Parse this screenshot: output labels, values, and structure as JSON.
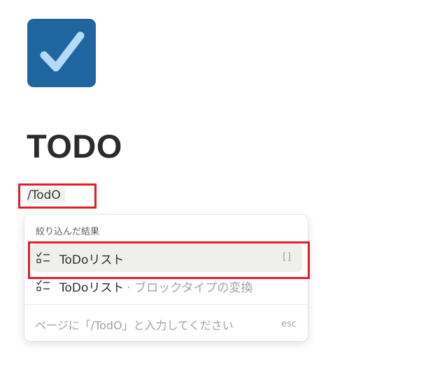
{
  "page": {
    "icon": "checkbox-icon",
    "title": "TODO"
  },
  "slash_command": {
    "value": "/TodO"
  },
  "menu": {
    "section_label": "絞り込んだ結果",
    "items": [
      {
        "icon": "todo-list-icon",
        "label": "ToDoリスト",
        "sublabel": "",
        "shortcut": "[]"
      },
      {
        "icon": "todo-list-icon",
        "label": "ToDoリスト",
        "sublabel": "· ブロックタイプの変換",
        "shortcut": ""
      }
    ],
    "footer_text": "ページに「/TodO」と入力してください",
    "esc_label": "esc"
  },
  "colors": {
    "icon_bg": "#1f66a0",
    "check": "#b5daf5",
    "highlight": "#e01e2b"
  }
}
